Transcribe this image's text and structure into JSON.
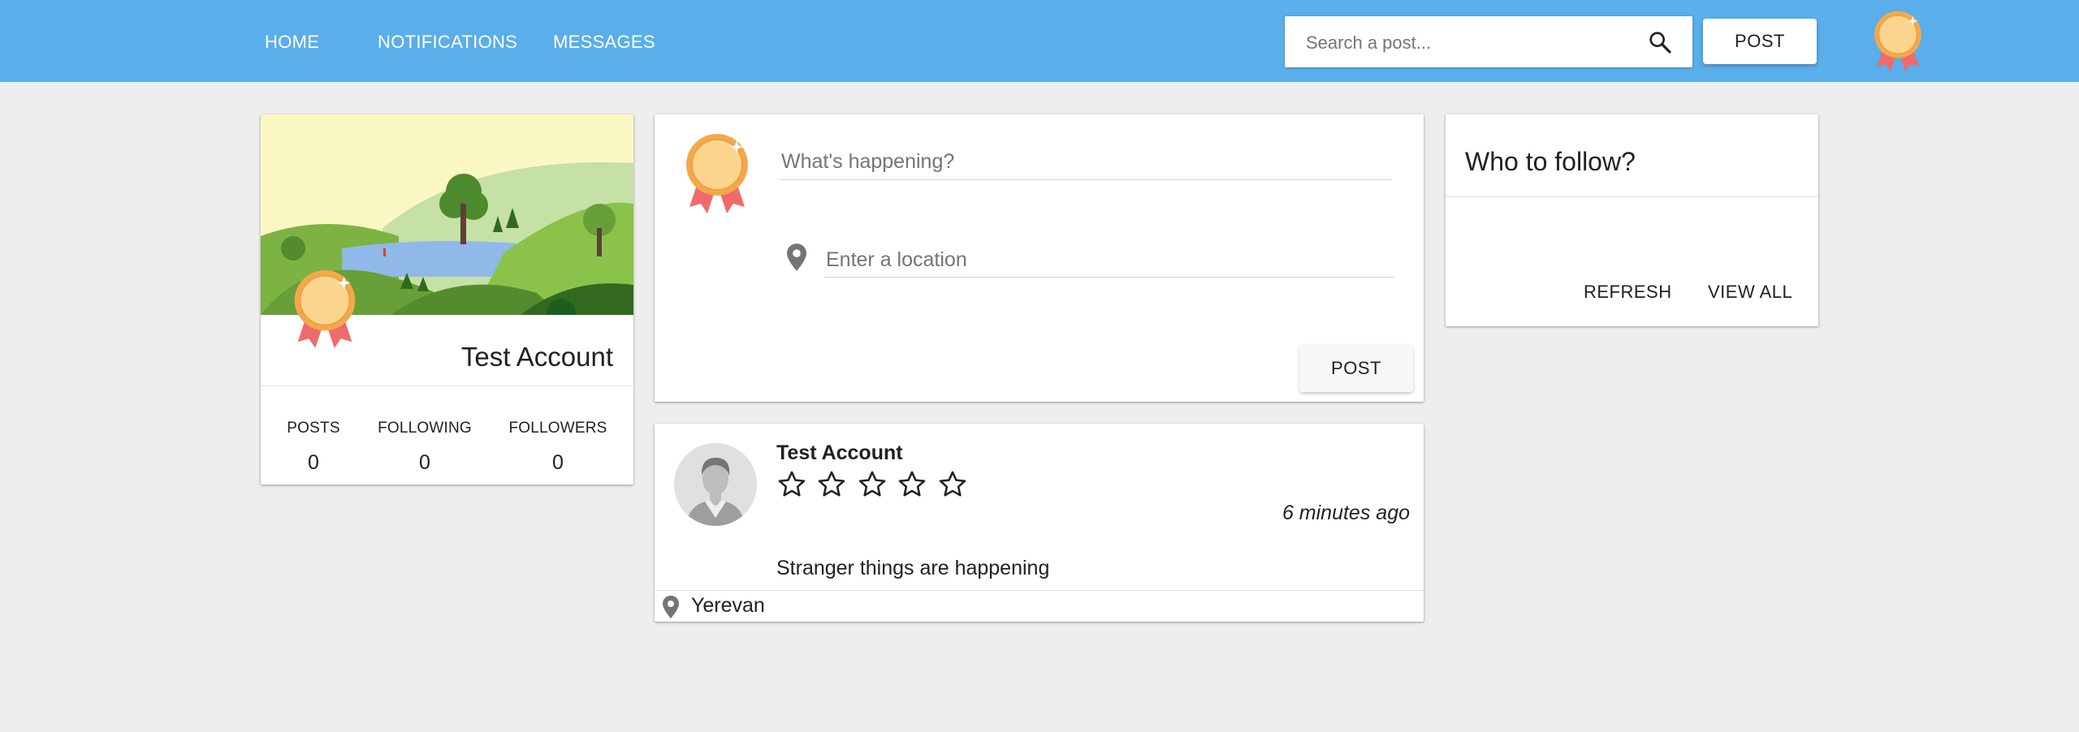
{
  "nav": {
    "home": "HOME",
    "notifications": "NOTIFICATIONS",
    "messages": "MESSAGES"
  },
  "search": {
    "placeholder": "Search a post...",
    "value": ""
  },
  "header": {
    "post_label": "POST",
    "avatar_icon": "medal-icon"
  },
  "profile": {
    "name": "Test Account",
    "cover_icon": "landscape-illustration",
    "stats": [
      {
        "label": "POSTS",
        "value": "0"
      },
      {
        "label": "FOLLOWING",
        "value": "0"
      },
      {
        "label": "FOLLOWERS",
        "value": "0"
      }
    ]
  },
  "compose": {
    "placeholder": "What's happening?",
    "location_placeholder": "Enter a location",
    "post_label": "POST"
  },
  "follow": {
    "title": "Who to follow?",
    "refresh_label": "REFRESH",
    "view_all_label": "VIEW ALL"
  },
  "post": {
    "author": "Test Account",
    "rating": 0,
    "rating_max": 5,
    "time": "6 minutes ago",
    "text": "Stranger things are happening",
    "location": "Yerevan"
  },
  "colors": {
    "topbar": "#5aaeea",
    "background": "#eeeeee",
    "medal_gold": "#f6b75a",
    "ribbon": "#ef6b6b"
  }
}
